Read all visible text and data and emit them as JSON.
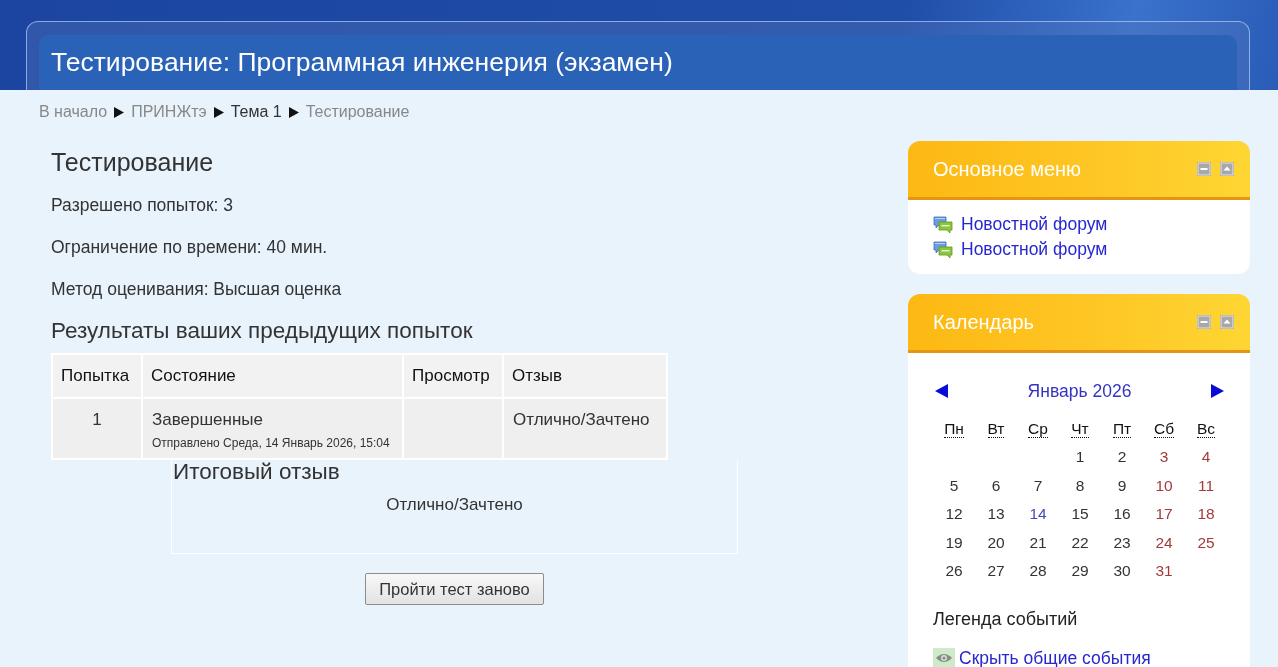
{
  "header": {
    "title": "Тестирование: Программная инженерия (экзамен)"
  },
  "breadcrumb": [
    {
      "label": "В начало",
      "kind": "link"
    },
    {
      "label": "ПРИНЖтэ",
      "kind": "link"
    },
    {
      "label": "Тема 1",
      "kind": "text"
    },
    {
      "label": "Тестирование",
      "kind": "link"
    }
  ],
  "quiz": {
    "title": "Тестирование",
    "info": [
      "Разрешено попыток: 3",
      "Ограничение по времени: 40 мин.",
      "Метод оценивания: Высшая оценка"
    ],
    "results_title": "Результаты ваших предыдущих попыток",
    "table": {
      "columns": [
        "Попытка",
        "Состояние",
        "Просмотр",
        "Отзыв"
      ],
      "rows": [
        {
          "attempt": "1",
          "state": "Завершенные",
          "submitted": "Отправлено Среда, 14 Январь 2026, 15:04",
          "feedback": "Отлично/Зачтено"
        }
      ]
    },
    "final_feedback": {
      "title": "Итоговый отзыв",
      "text": "Отлично/Зачтено"
    },
    "button": "Пройти тест заново"
  },
  "sidebar": [
    {
      "kind": "menu",
      "title": "Основное меню",
      "items": [
        {
          "label": "Новостной форум"
        },
        {
          "label": "Новостной форум"
        }
      ]
    },
    {
      "kind": "calendar",
      "title": "Календарь",
      "month": "Январь 2026",
      "weekdays": [
        "Пн",
        "Вт",
        "Ср",
        "Чт",
        "Пт",
        "Сб",
        "Вс"
      ],
      "weeks": [
        [
          {
            "day": "1",
            "kind": "weekday"
          },
          {
            "day": "2",
            "kind": "weekday"
          },
          {
            "day": "3",
            "kind": "weekend"
          },
          {
            "day": "4",
            "kind": "weekend"
          }
        ],
        [
          {
            "day": "5",
            "kind": "weekday"
          },
          {
            "day": "6",
            "kind": "weekday"
          },
          {
            "day": "7",
            "kind": "weekday"
          },
          {
            "day": "8",
            "kind": "weekday"
          },
          {
            "day": "9",
            "kind": "weekday"
          },
          {
            "day": "10",
            "kind": "weekend"
          },
          {
            "day": "11",
            "kind": "weekend"
          }
        ],
        [
          {
            "day": "12",
            "kind": "weekday"
          },
          {
            "day": "13",
            "kind": "weekday"
          },
          {
            "day": "14",
            "kind": "event"
          },
          {
            "day": "15",
            "kind": "weekday"
          },
          {
            "day": "16",
            "kind": "weekday"
          },
          {
            "day": "17",
            "kind": "weekend"
          },
          {
            "day": "18",
            "kind": "weekend"
          }
        ],
        [
          {
            "day": "19",
            "kind": "weekday"
          },
          {
            "day": "20",
            "kind": "weekday"
          },
          {
            "day": "21",
            "kind": "weekday"
          },
          {
            "day": "22",
            "kind": "weekday"
          },
          {
            "day": "23",
            "kind": "weekday"
          },
          {
            "day": "24",
            "kind": "weekend"
          },
          {
            "day": "25",
            "kind": "weekend"
          }
        ],
        [
          {
            "day": "26",
            "kind": "weekday"
          },
          {
            "day": "27",
            "kind": "weekday"
          },
          {
            "day": "28",
            "kind": "weekday"
          },
          {
            "day": "29",
            "kind": "weekday"
          },
          {
            "day": "30",
            "kind": "weekday"
          },
          {
            "day": "31",
            "kind": "weekend"
          }
        ]
      ],
      "legend": {
        "title": "Легенда событий",
        "items": [
          {
            "label": "Скрыть общие события"
          }
        ]
      }
    }
  ]
}
